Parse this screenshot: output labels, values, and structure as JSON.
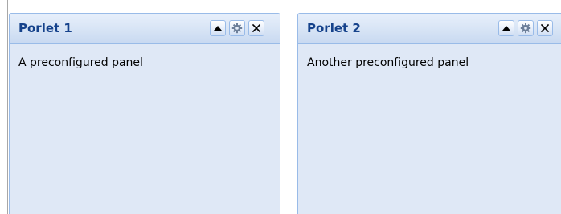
{
  "portlets": [
    {
      "title": "Porlet 1",
      "body": "A preconfigured panel",
      "tools": [
        "collapse-up-icon",
        "gear-icon",
        "close-icon"
      ]
    },
    {
      "title": "Porlet 2",
      "body": "Another preconfigured panel",
      "tools": [
        "collapse-up-icon",
        "gear-icon",
        "close-icon"
      ]
    }
  ],
  "colors": {
    "header_text": "#15428b",
    "panel_border": "#99bbe8",
    "panel_background": "#dfe8f6"
  }
}
